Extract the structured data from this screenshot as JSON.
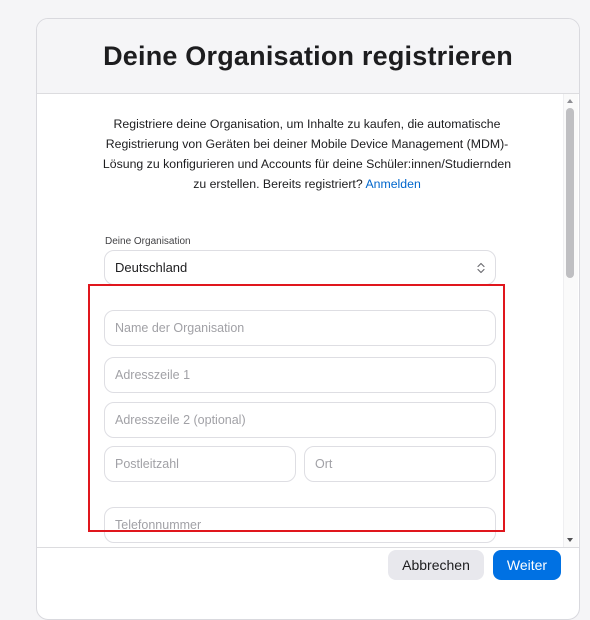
{
  "dialog": {
    "title": "Deine Organisation registrieren"
  },
  "intro": {
    "text": "Registriere deine Organisation, um Inhalte zu kaufen, die automatische Registrierung von Geräten bei deiner Mobile Device Management (MDM)-Lösung zu konfigurieren und Accounts für deine Schüler:innen/Studiernden zu erstellen. Bereits registriert?",
    "link": "Anmelden"
  },
  "organization": {
    "label": "Deine Organisation",
    "selected": "Deutschland"
  },
  "form": {
    "org_name_placeholder": "Name der Organisation",
    "address1_placeholder": "Adresszeile 1",
    "address2_placeholder": "Adresszeile 2 (optional)",
    "postal_placeholder": "Postleitzahl",
    "city_placeholder": "Ort",
    "phone_placeholder": "Telefonnummer"
  },
  "footer": {
    "cancel_label": "Abbrechen",
    "next_label": "Weiter"
  },
  "colors": {
    "accent": "#0071e3",
    "link": "#0066cc",
    "highlight": "#e0161d"
  }
}
